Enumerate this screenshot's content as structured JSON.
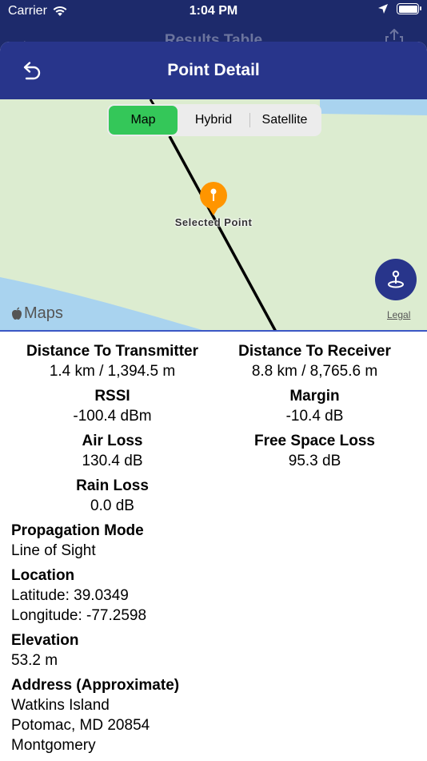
{
  "status_bar": {
    "carrier": "Carrier",
    "time": "1:04 PM"
  },
  "underlay": {
    "title": "Results Table"
  },
  "nav": {
    "title": "Point Detail"
  },
  "map": {
    "segments": [
      "Map",
      "Hybrid",
      "Satellite"
    ],
    "selected_segment": "Map",
    "pin_label": "Selected Point",
    "maps_logo": "Maps",
    "legal": "Legal",
    "colors": {
      "land": "#dcecd0",
      "water": "#a9d3ef",
      "route": "#000000",
      "pin": "#ff9500",
      "accent": "#28358b",
      "segment_active": "#34c759"
    }
  },
  "metrics": [
    {
      "label": "Distance To Transmitter",
      "value": "1.4 km / 1,394.5 m"
    },
    {
      "label": "Distance To Receiver",
      "value": "8.8 km / 8,765.6 m"
    },
    {
      "label": "RSSI",
      "value": "-100.4 dBm"
    },
    {
      "label": "Margin",
      "value": "-10.4 dB"
    },
    {
      "label": "Air Loss",
      "value": "130.4 dB"
    },
    {
      "label": "Free Space Loss",
      "value": "95.3 dB"
    },
    {
      "label": "Rain Loss",
      "value": "0.0 dB"
    }
  ],
  "propagation": {
    "label": "Propagation Mode",
    "value": "Line of Sight"
  },
  "location": {
    "label": "Location",
    "latitude": "Latitude: 39.0349",
    "longitude": "Longitude: -77.2598"
  },
  "elevation": {
    "label": "Elevation",
    "value": "53.2 m"
  },
  "address": {
    "label": "Address (Approximate)",
    "line1": "Watkins Island",
    "line2": "Potomac, MD 20854",
    "line3": "Montgomery"
  }
}
